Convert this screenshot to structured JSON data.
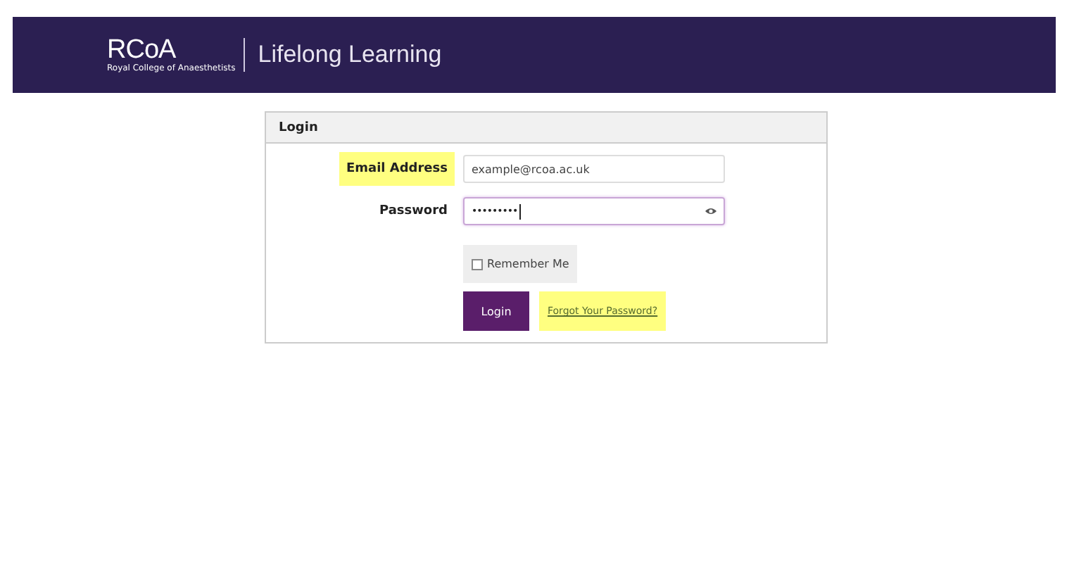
{
  "header": {
    "logo": "RCoA",
    "logo_subtitle": "Royal College of Anaesthetists",
    "title": "Lifelong Learning"
  },
  "login_panel": {
    "title": "Login",
    "fields": [
      {
        "label": "Email Address",
        "value": "example@rcoa.ac.uk",
        "label_highlighted": true,
        "focused": false,
        "kind": "text"
      },
      {
        "label": "Password",
        "value": "•••••••••",
        "label_highlighted": false,
        "focused": true,
        "kind": "password"
      }
    ],
    "remember": {
      "label": "Remember Me",
      "checked": false
    },
    "login_button": "Login",
    "forgot_link": {
      "label": "Forgot Your Password?",
      "highlighted": true
    }
  }
}
